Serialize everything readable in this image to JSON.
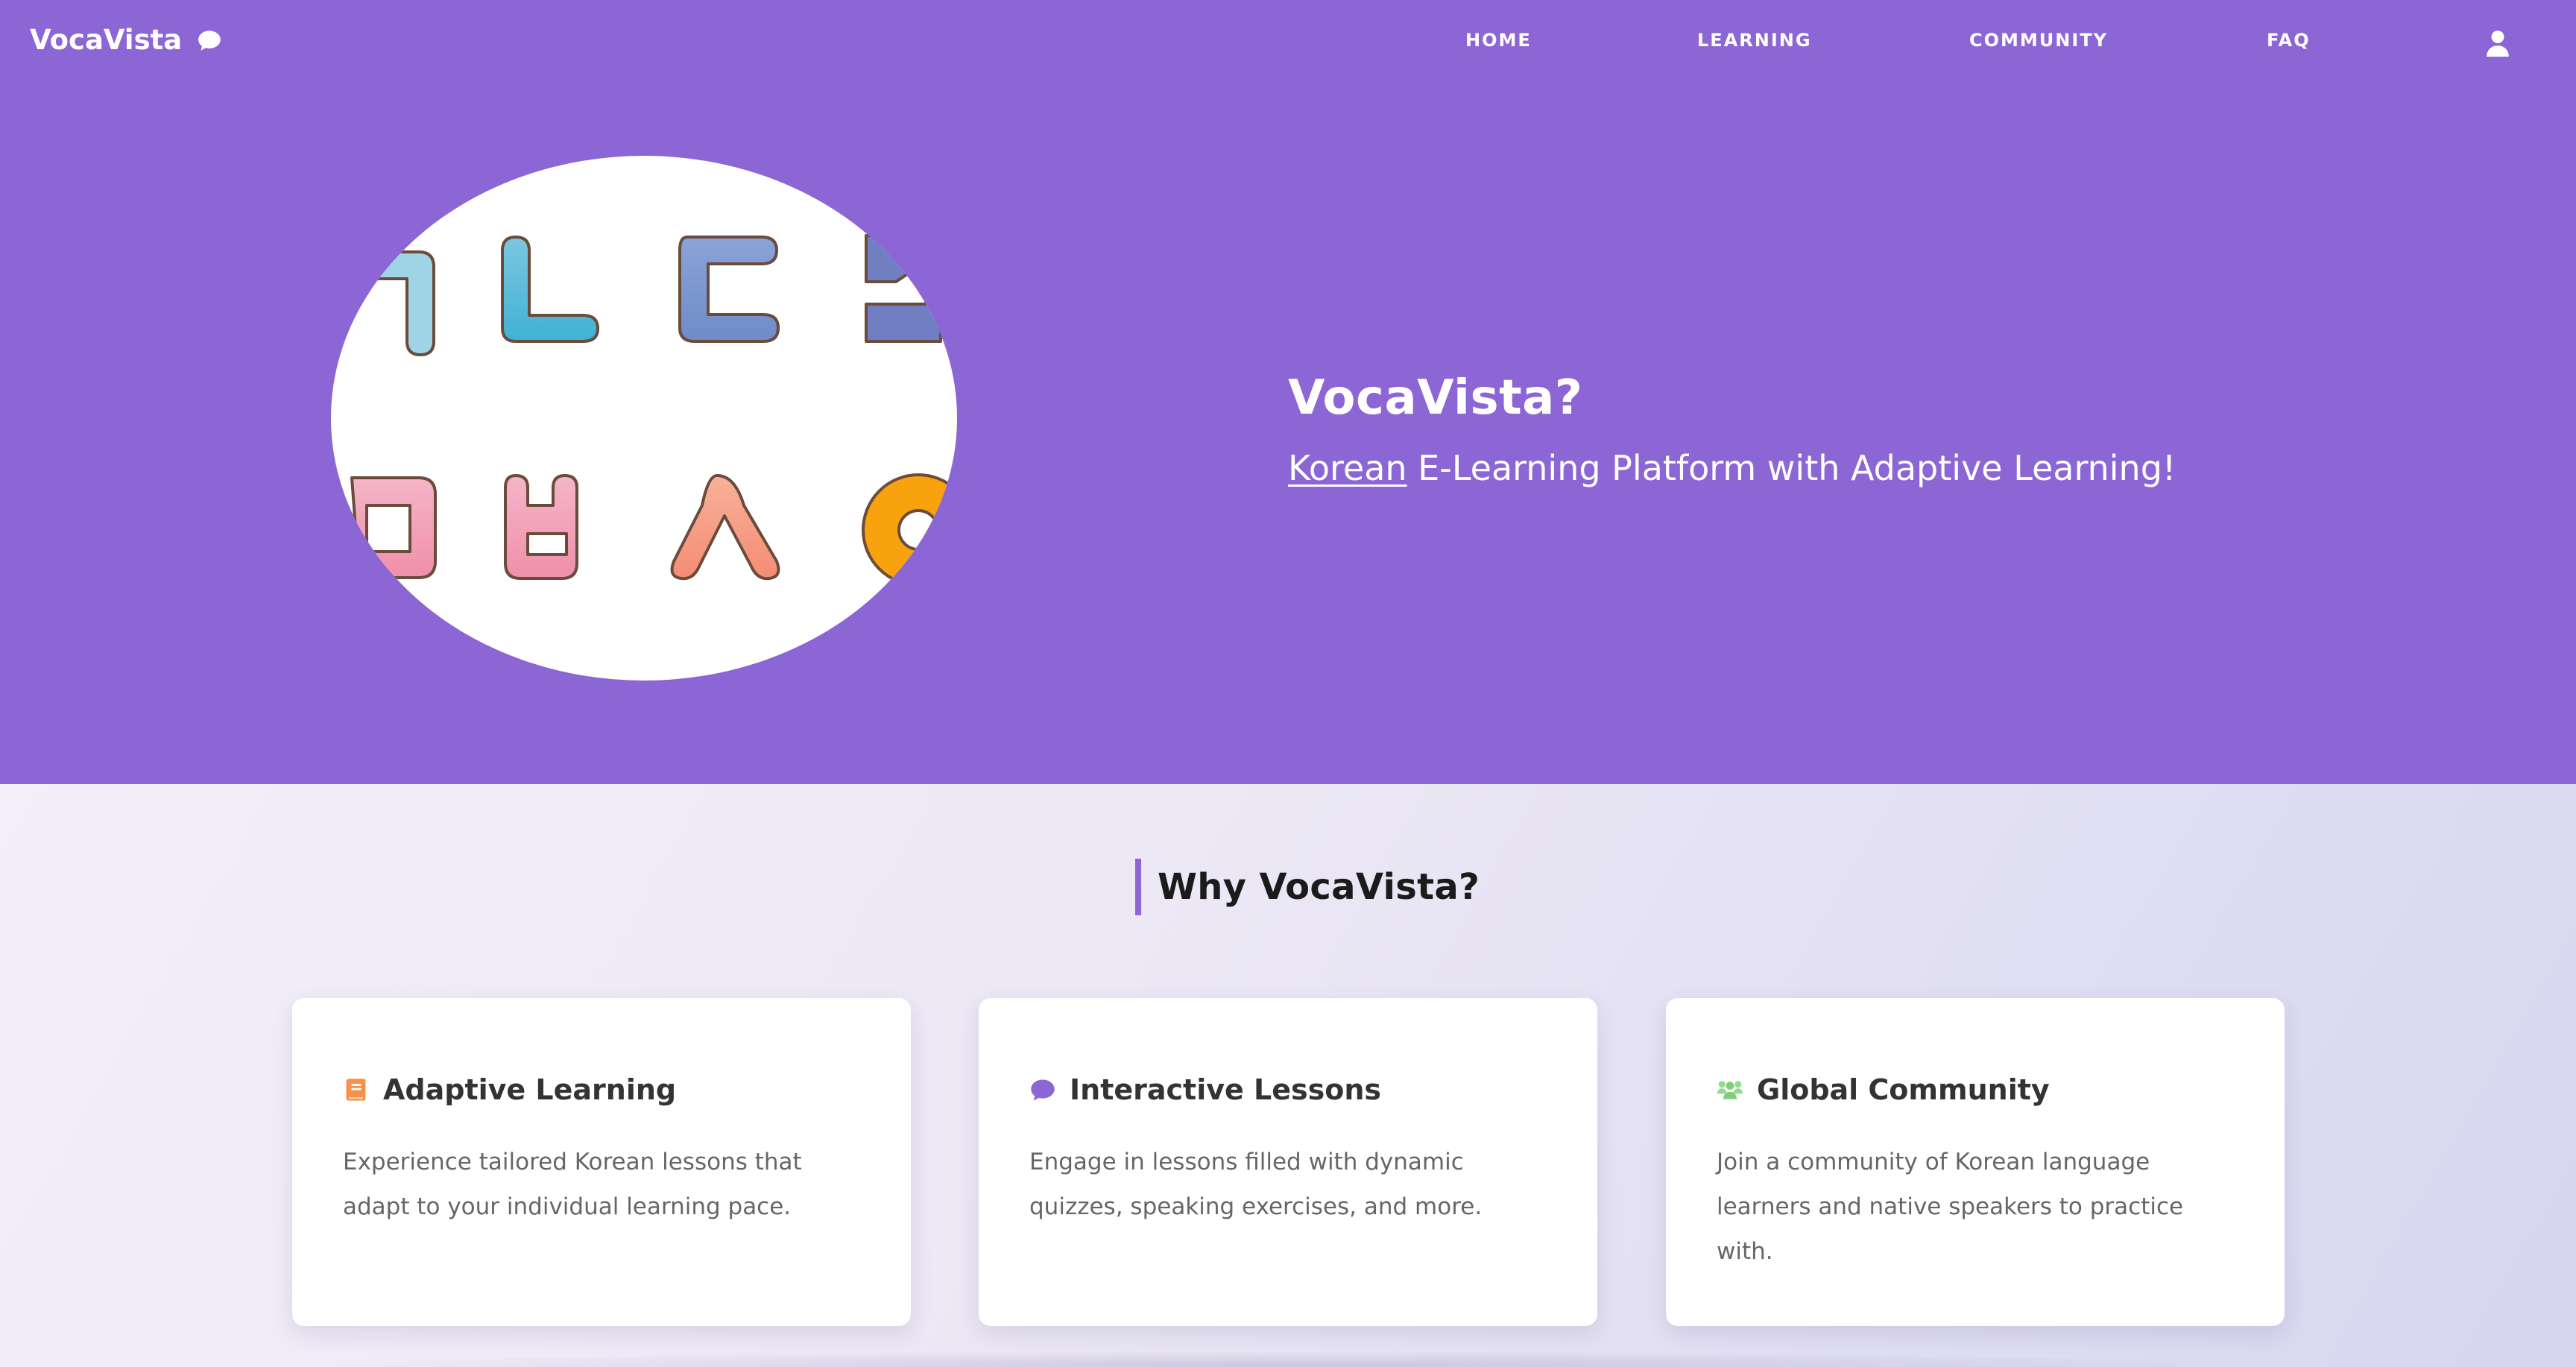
{
  "header": {
    "brand": "VocaVista",
    "brand_icon": "chat-bubble-icon",
    "nav": [
      {
        "label": "HOME"
      },
      {
        "label": "LEARNING"
      },
      {
        "label": "COMMUNITY"
      },
      {
        "label": "FAQ"
      }
    ],
    "user_icon": "user-icon"
  },
  "hero": {
    "title": "VocaVista?",
    "subtitle_highlight": "Korean",
    "subtitle_rest": " E-Learning Platform with Adaptive Learning!",
    "image_icon": "hangul-letters-illustration"
  },
  "features": {
    "heading": "Why VocaVista?",
    "cards": [
      {
        "title": "Adaptive Learning",
        "description": "Experience tailored Korean lessons that adapt to your individual learning pace.",
        "icon": "book-icon",
        "icon_color": "#f7904a"
      },
      {
        "title": "Interactive Lessons",
        "description": "Engage in lessons filled with dynamic quizzes, speaking exercises, and more.",
        "icon": "chat-bubble-icon",
        "icon_color": "#8b66d4"
      },
      {
        "title": "Global Community",
        "description": "Join a community of Korean language learners and native speakers to practice with.",
        "icon": "users-icon",
        "icon_color": "#8fdc8f"
      }
    ]
  },
  "colors": {
    "primary": "#8b66d4",
    "background_light": "#f3eff9",
    "text_dark": "#1b1b1b"
  }
}
